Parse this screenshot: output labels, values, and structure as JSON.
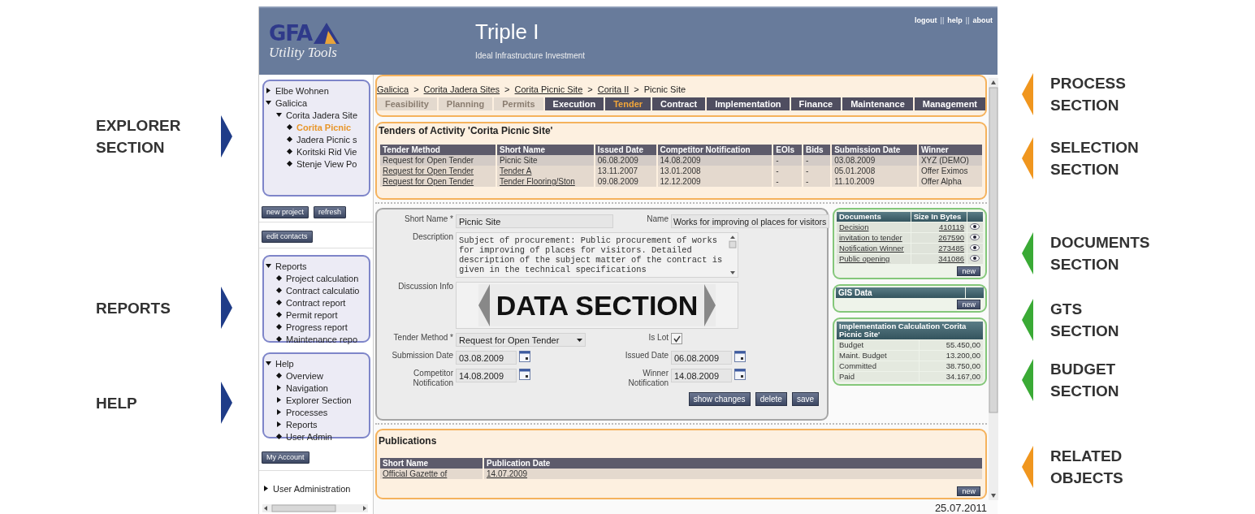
{
  "annotations_left": [
    {
      "label": "EXPLORER SECTION",
      "color": "#1f3c88"
    },
    {
      "label": "REPORTS",
      "color": "#1f3c88"
    },
    {
      "label": "HELP",
      "color": "#1f3c88"
    }
  ],
  "header": {
    "logo_title": "GFA",
    "logo_subtitle": "Utility Tools",
    "title": "Triple I",
    "subtitle": "Ideal Infrastructure Investment",
    "top_links": [
      {
        "label": "logout",
        "kind": "link"
      },
      {
        "label": "||",
        "kind": "separator"
      },
      {
        "label": "help",
        "kind": "link"
      },
      {
        "label": "||",
        "kind": "separator"
      },
      {
        "label": "about",
        "kind": "link"
      }
    ]
  },
  "explorer": {
    "items": [
      {
        "label": "Elbe Wohnen",
        "kind": "folder",
        "expanded": false,
        "selected": false
      },
      {
        "label": "Galicica",
        "kind": "folder",
        "expanded": true,
        "selected": false,
        "children": [
          {
            "label": "Corita Jadera Site",
            "kind": "folder",
            "expanded": true,
            "selected": false,
            "children": [
              {
                "label": "Corita Picnic",
                "kind": "leaf",
                "selected": true
              },
              {
                "label": "Jadera Picnic s",
                "kind": "leaf",
                "selected": false
              },
              {
                "label": "Koritski Rid Vie",
                "kind": "leaf",
                "selected": false
              },
              {
                "label": "Stenje View Po",
                "kind": "leaf",
                "selected": false
              }
            ]
          }
        ]
      }
    ]
  },
  "explorer_buttons": [
    "new project",
    "refresh"
  ],
  "contacts_button": "edit contacts",
  "reports": {
    "title": "Reports",
    "expanded": true,
    "items": [
      {
        "label": "Project calculation",
        "kind": "leaf"
      },
      {
        "label": "Contract calculatio",
        "kind": "leaf"
      },
      {
        "label": "Contract report",
        "kind": "leaf"
      },
      {
        "label": "Permit report",
        "kind": "leaf"
      },
      {
        "label": "Progress report",
        "kind": "leaf"
      },
      {
        "label": "Maintenance repo",
        "kind": "leaf"
      }
    ]
  },
  "help": {
    "title": "Help",
    "expanded": true,
    "items": [
      {
        "label": "Overview",
        "kind": "leaf"
      },
      {
        "label": "Navigation",
        "kind": "folder",
        "expanded": false
      },
      {
        "label": "Explorer Section",
        "kind": "folder",
        "expanded": false
      },
      {
        "label": "Processes",
        "kind": "folder",
        "expanded": false
      },
      {
        "label": "Reports",
        "kind": "folder",
        "expanded": false
      },
      {
        "label": "User Admin",
        "kind": "leaf"
      }
    ]
  },
  "account_button": "My Account",
  "user_administration": {
    "label": "User Administration",
    "expanded": false
  },
  "breadcrumb": [
    {
      "label": "Galicica",
      "kind": "link"
    },
    {
      "label": ">",
      "kind": "separator"
    },
    {
      "label": "Corita Jadera Sites",
      "kind": "link"
    },
    {
      "label": ">",
      "kind": "separator"
    },
    {
      "label": "Corita Picnic Site",
      "kind": "link"
    },
    {
      "label": ">",
      "kind": "separator"
    },
    {
      "label": "Corita II",
      "kind": "link"
    },
    {
      "label": ">",
      "kind": "separator"
    },
    {
      "label": "Picnic Site",
      "kind": "current"
    }
  ],
  "process_tabs": [
    {
      "label": "Feasibility",
      "disabled": true,
      "selected": false
    },
    {
      "label": "Planning",
      "disabled": true,
      "selected": false
    },
    {
      "label": "Permits",
      "disabled": true,
      "selected": false
    },
    {
      "label": "Execution",
      "disabled": false,
      "selected": false
    },
    {
      "label": "Tender",
      "disabled": false,
      "selected": true
    },
    {
      "label": "Contract",
      "disabled": false,
      "selected": false
    },
    {
      "label": "Implementation",
      "disabled": false,
      "selected": false
    },
    {
      "label": "Finance",
      "disabled": false,
      "selected": false
    },
    {
      "label": "Maintenance",
      "disabled": false,
      "selected": false
    },
    {
      "label": "Management",
      "disabled": false,
      "selected": false
    }
  ],
  "tenders": {
    "title": "Tenders of Activity 'Corita Picnic Site'",
    "columns": [
      "Tender Method",
      "Short Name",
      "Issued Date",
      "Competitor Notification",
      "EOIs",
      "Bids",
      "Submission Date",
      "Winner"
    ],
    "rows": [
      {
        "selected": true,
        "cells": [
          "Request for Open Tender",
          "Picnic Site",
          "06.08.2009",
          "14.08.2009",
          "-",
          "-",
          "03.08.2009",
          "XYZ (DEMO)"
        ]
      },
      {
        "selected": false,
        "cells": [
          "Request for Open Tender",
          "Tender A",
          "13.11.2007",
          "13.01.2008",
          "-",
          "-",
          "05.01.2008",
          "Offer Eximos"
        ]
      },
      {
        "selected": false,
        "cells": [
          "Request for Open Tender",
          "Tender Flooring/Ston",
          "09.08.2009",
          "12.12.2009",
          "-",
          "-",
          "11.10.2009",
          "Offer Alpha"
        ]
      }
    ]
  },
  "form": {
    "short_name": {
      "label": "Short Name *",
      "value": "Picnic Site"
    },
    "name": {
      "label": "Name",
      "value": "Works for improving ol places for visitors"
    },
    "description": {
      "label": "Description",
      "value": "Subject of procurement: Public procurement of works for improving of places for visitors. Detailed description of the subject matter of the contract is given in the technical specifications"
    },
    "discussion": {
      "label": "Discussion Info"
    },
    "tender_method": {
      "label": "Tender Method *",
      "value": "Request for Open Tender"
    },
    "is_lot": {
      "label": "Is Lot",
      "checked": true
    },
    "submission_date": {
      "label": "Submission Date",
      "value": "03.08.2009"
    },
    "issued_date": {
      "label": "Issued Date",
      "value": "06.08.2009"
    },
    "competitor_notification": {
      "label": "Competitor Notification",
      "value": "14.08.2009"
    },
    "winner_notification": {
      "label": "Winner Notification",
      "value": "14.08.2009"
    },
    "buttons": [
      "show changes",
      "delete",
      "save"
    ]
  },
  "data_section_callout": {
    "label": "DATA SECTION"
  },
  "documents": {
    "columns": [
      "Documents",
      "Size In Bytes"
    ],
    "rows": [
      {
        "name": "Decision",
        "size": "410119"
      },
      {
        "name": "invitation to tender",
        "size": "267590"
      },
      {
        "name": "Notification Winner",
        "size": "273485"
      },
      {
        "name": "Public opening",
        "size": "341086"
      }
    ],
    "button": "new"
  },
  "gis": {
    "title": "GIS Data",
    "button": "new"
  },
  "budget": {
    "title": "Implementation Calculation 'Corita Picnic Site'",
    "rows": [
      {
        "label": "Budget",
        "value": "55.450,00"
      },
      {
        "label": "Maint. Budget",
        "value": "13.200,00"
      },
      {
        "label": "Committed",
        "value": "38.750,00"
      },
      {
        "label": "Paid",
        "value": "34.167,00"
      }
    ]
  },
  "publications": {
    "title": "Publications",
    "columns": [
      "Short Name",
      "Publication Date"
    ],
    "rows": [
      {
        "cells": [
          "Official Gazette of",
          "14.07.2009"
        ]
      }
    ],
    "button": "new"
  },
  "footer_date": "25.07.2011",
  "annotations_right": [
    {
      "label": "PROCESS SECTION",
      "color": "#f0961e"
    },
    {
      "label": "SELECTION SECTION",
      "color": "#f0961e"
    },
    {
      "label": "DOCUMENTS SECTION",
      "color": "#3aaa35"
    },
    {
      "label": "GTS SECTION",
      "color": "#3aaa35"
    },
    {
      "label": "BUDGET SECTION",
      "color": "#3aaa35"
    },
    {
      "label": "RELATED OBJECTS",
      "color": "#f0961e"
    }
  ]
}
